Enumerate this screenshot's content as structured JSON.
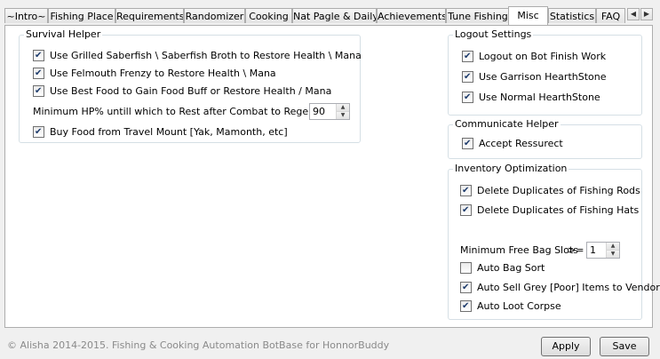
{
  "tabs": [
    {
      "label": "~Intro~",
      "active": false
    },
    {
      "label": "Fishing Place",
      "active": false
    },
    {
      "label": "Requirements",
      "active": false
    },
    {
      "label": "Randomizer",
      "active": false
    },
    {
      "label": "Cooking",
      "active": false
    },
    {
      "label": "Nat Pagle & Daily",
      "active": false
    },
    {
      "label": "Achievements",
      "active": false
    },
    {
      "label": "Tune Fishing",
      "active": false
    },
    {
      "label": "Misc",
      "active": true
    },
    {
      "label": "Statistics",
      "active": false
    },
    {
      "label": "FAQ",
      "active": false
    }
  ],
  "tab_scroll": {
    "left_icon": "arrow-left-icon",
    "right_icon": "arrow-right-icon"
  },
  "survival": {
    "title": "Survival Helper",
    "items": [
      {
        "label": "Use Grilled Saberfish \\ Saberfish Broth to Restore Health \\ Mana",
        "checked": true
      },
      {
        "label": "Use Felmouth Frenzy to Restore Health \\ Mana",
        "checked": true
      },
      {
        "label": "Use Best Food to Gain Food Buff or Restore Health / Mana",
        "checked": true
      }
    ],
    "min_hp_label": "Minimum HP% untill which to Rest after Combat to Regen HP/MP",
    "min_hp_value": "90",
    "buy_food": {
      "label": "Buy Food from Travel Mount [Yak, Mamonth, etc]",
      "checked": true
    }
  },
  "logout": {
    "title": "Logout Settings",
    "items": [
      {
        "label": "Logout on Bot Finish Work",
        "checked": true
      },
      {
        "label": "Use Garrison HearthStone",
        "checked": true
      },
      {
        "label": "Use Normal HearthStone",
        "checked": true
      }
    ]
  },
  "communicate": {
    "title": "Communicate Helper",
    "items": [
      {
        "label": "Accept Ressurect",
        "checked": true
      }
    ]
  },
  "inventory": {
    "title": "Inventory Optimization",
    "items": [
      {
        "label": "Delete Duplicates of Fishing Rods",
        "checked": true
      },
      {
        "label": "Delete Duplicates of Fishing Hats",
        "checked": true
      }
    ],
    "min_slots_label": "Minimum Free Bag Slots",
    "min_slots_op": ">=",
    "min_slots_value": "1",
    "items2": [
      {
        "label": "Auto Bag Sort",
        "checked": false
      },
      {
        "label": "Auto Sell Grey [Poor] Items to Vendor",
        "checked": true
      },
      {
        "label": "Auto Loot Corpse",
        "checked": true
      }
    ]
  },
  "footer": {
    "copyright": "© Alisha 2014-2015. Fishing  & Cooking Automation BotBase for HonnorBuddy",
    "apply_label": "Apply",
    "save_label": "Save"
  }
}
